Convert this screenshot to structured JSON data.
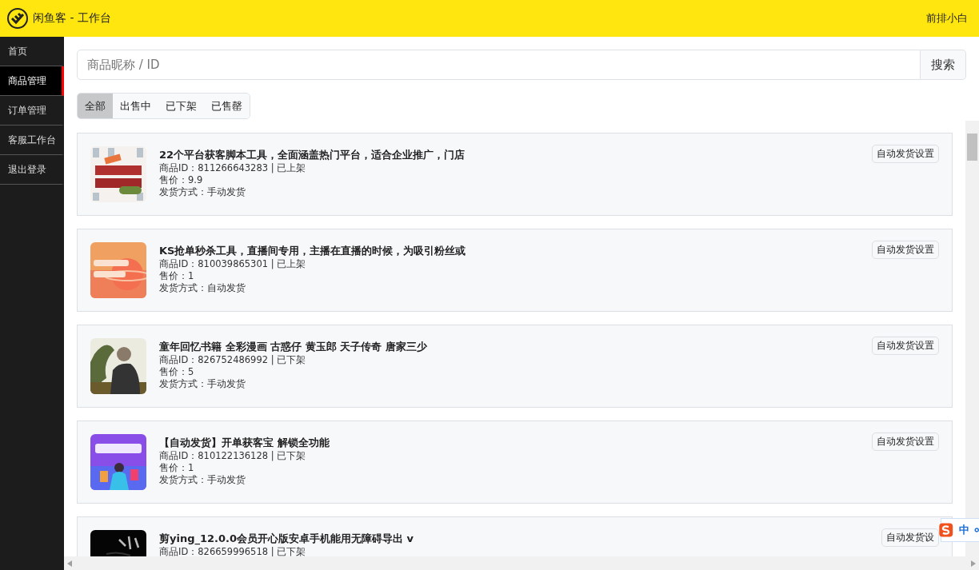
{
  "header": {
    "title": "闲鱼客 - 工作台",
    "user": "前排小白"
  },
  "sidebar": {
    "items": [
      {
        "label": "首页",
        "selected": false
      },
      {
        "label": "商品管理",
        "selected": true
      },
      {
        "label": "订单管理",
        "selected": false
      },
      {
        "label": "客服工作台",
        "selected": false
      },
      {
        "label": "退出登录",
        "selected": false
      }
    ]
  },
  "search": {
    "placeholder": "商品昵称 / ID",
    "button": "搜索"
  },
  "filters": [
    {
      "label": "全部",
      "selected": true
    },
    {
      "label": "出售中",
      "selected": false
    },
    {
      "label": "已下架",
      "selected": false
    },
    {
      "label": "已售罄",
      "selected": false
    }
  ],
  "products": [
    {
      "title": "22个平台获客脚本工具，全面涵盖热门平台，适合企业推广，门店",
      "id_line": "商品ID：811266643283 | 已上架",
      "price": "售价：9.9",
      "shipping": "发货方式：手动发货",
      "button": "自动发货设置"
    },
    {
      "title": "KS抢单秒杀工具，直播间专用，主播在直播的时候，为吸引粉丝或",
      "id_line": "商品ID：810039865301 | 已上架",
      "price": "售价：1",
      "shipping": "发货方式：自动发货",
      "button": "自动发货设置"
    },
    {
      "title": "童年回忆书籍 全彩漫画 古惑仔 黄玉郎 天子传奇 唐家三少",
      "id_line": "商品ID：826752486992 | 已下架",
      "price": "售价：5",
      "shipping": "发货方式：手动发货",
      "button": "自动发货设置"
    },
    {
      "title": "【自动发货】开单获客宝 解锁全功能",
      "id_line": "商品ID：810122136128 | 已下架",
      "price": "售价：1",
      "shipping": "发货方式：手动发货",
      "button": "自动发货设置"
    },
    {
      "title": "剪ying_12.0.0会员开心版安卓手机能用无障碍导出 v",
      "id_line": "商品ID：826659996518 | 已下架",
      "button": "自动发货设"
    }
  ],
  "ime": {
    "label": "中"
  }
}
